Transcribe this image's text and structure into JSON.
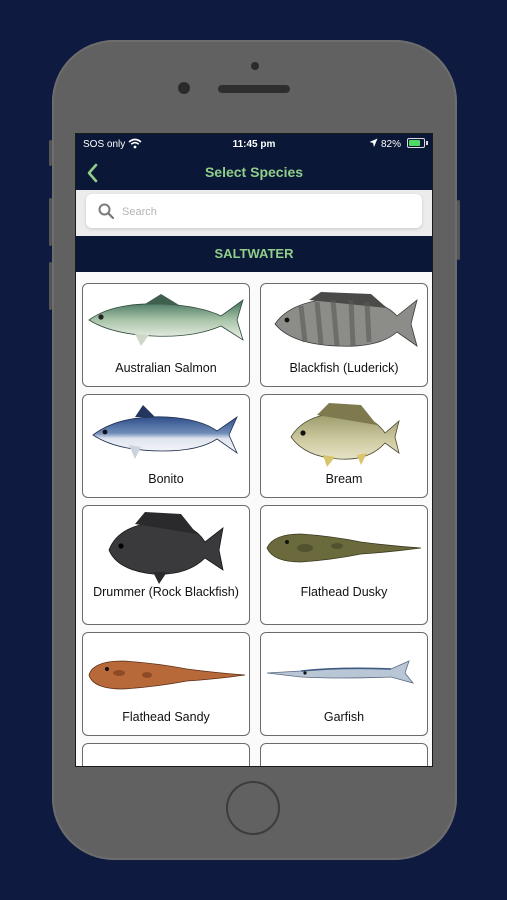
{
  "status": {
    "carrier": "SOS only",
    "time": "11:45 pm",
    "battery": "82%",
    "battery_level": 0.82
  },
  "nav": {
    "title": "Select Species"
  },
  "search": {
    "placeholder": "Search",
    "value": ""
  },
  "section": {
    "title": "SALTWATER"
  },
  "species": [
    {
      "label": "Australian Salmon"
    },
    {
      "label": "Blackfish (Luderick)"
    },
    {
      "label": "Bonito"
    },
    {
      "label": "Bream"
    },
    {
      "label": "Drummer (Rock Blackfish)"
    },
    {
      "label": "Flathead Dusky"
    },
    {
      "label": "Flathead Sandy"
    },
    {
      "label": "Garfish"
    }
  ],
  "colors": {
    "navy": "#0b1736",
    "accent_green": "#8fcf8a",
    "background": "#0e1a3f"
  },
  "icons": [
    "wifi-icon",
    "location-arrow-icon",
    "battery-icon",
    "back-chevron-icon",
    "search-icon"
  ]
}
